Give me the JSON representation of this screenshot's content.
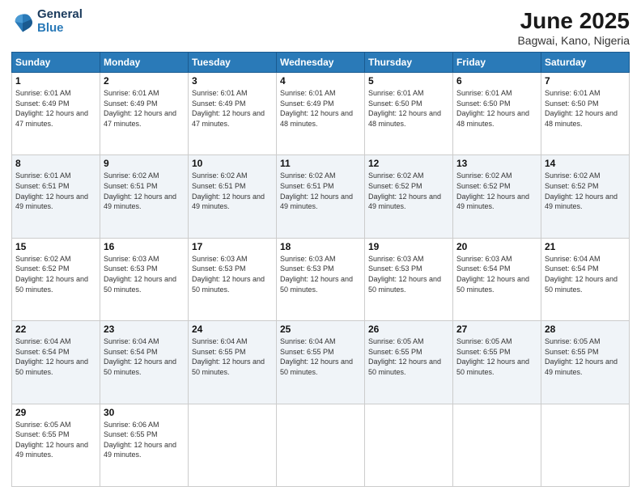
{
  "logo": {
    "line1": "General",
    "line2": "Blue"
  },
  "title": "June 2025",
  "location": "Bagwai, Kano, Nigeria",
  "weekdays": [
    "Sunday",
    "Monday",
    "Tuesday",
    "Wednesday",
    "Thursday",
    "Friday",
    "Saturday"
  ],
  "weeks": [
    [
      {
        "day": "1",
        "sunrise": "6:01 AM",
        "sunset": "6:49 PM",
        "daylight": "12 hours and 47 minutes."
      },
      {
        "day": "2",
        "sunrise": "6:01 AM",
        "sunset": "6:49 PM",
        "daylight": "12 hours and 47 minutes."
      },
      {
        "day": "3",
        "sunrise": "6:01 AM",
        "sunset": "6:49 PM",
        "daylight": "12 hours and 47 minutes."
      },
      {
        "day": "4",
        "sunrise": "6:01 AM",
        "sunset": "6:49 PM",
        "daylight": "12 hours and 48 minutes."
      },
      {
        "day": "5",
        "sunrise": "6:01 AM",
        "sunset": "6:50 PM",
        "daylight": "12 hours and 48 minutes."
      },
      {
        "day": "6",
        "sunrise": "6:01 AM",
        "sunset": "6:50 PM",
        "daylight": "12 hours and 48 minutes."
      },
      {
        "day": "7",
        "sunrise": "6:01 AM",
        "sunset": "6:50 PM",
        "daylight": "12 hours and 48 minutes."
      }
    ],
    [
      {
        "day": "8",
        "sunrise": "6:01 AM",
        "sunset": "6:51 PM",
        "daylight": "12 hours and 49 minutes."
      },
      {
        "day": "9",
        "sunrise": "6:02 AM",
        "sunset": "6:51 PM",
        "daylight": "12 hours and 49 minutes."
      },
      {
        "day": "10",
        "sunrise": "6:02 AM",
        "sunset": "6:51 PM",
        "daylight": "12 hours and 49 minutes."
      },
      {
        "day": "11",
        "sunrise": "6:02 AM",
        "sunset": "6:51 PM",
        "daylight": "12 hours and 49 minutes."
      },
      {
        "day": "12",
        "sunrise": "6:02 AM",
        "sunset": "6:52 PM",
        "daylight": "12 hours and 49 minutes."
      },
      {
        "day": "13",
        "sunrise": "6:02 AM",
        "sunset": "6:52 PM",
        "daylight": "12 hours and 49 minutes."
      },
      {
        "day": "14",
        "sunrise": "6:02 AM",
        "sunset": "6:52 PM",
        "daylight": "12 hours and 49 minutes."
      }
    ],
    [
      {
        "day": "15",
        "sunrise": "6:02 AM",
        "sunset": "6:52 PM",
        "daylight": "12 hours and 50 minutes."
      },
      {
        "day": "16",
        "sunrise": "6:03 AM",
        "sunset": "6:53 PM",
        "daylight": "12 hours and 50 minutes."
      },
      {
        "day": "17",
        "sunrise": "6:03 AM",
        "sunset": "6:53 PM",
        "daylight": "12 hours and 50 minutes."
      },
      {
        "day": "18",
        "sunrise": "6:03 AM",
        "sunset": "6:53 PM",
        "daylight": "12 hours and 50 minutes."
      },
      {
        "day": "19",
        "sunrise": "6:03 AM",
        "sunset": "6:53 PM",
        "daylight": "12 hours and 50 minutes."
      },
      {
        "day": "20",
        "sunrise": "6:03 AM",
        "sunset": "6:54 PM",
        "daylight": "12 hours and 50 minutes."
      },
      {
        "day": "21",
        "sunrise": "6:04 AM",
        "sunset": "6:54 PM",
        "daylight": "12 hours and 50 minutes."
      }
    ],
    [
      {
        "day": "22",
        "sunrise": "6:04 AM",
        "sunset": "6:54 PM",
        "daylight": "12 hours and 50 minutes."
      },
      {
        "day": "23",
        "sunrise": "6:04 AM",
        "sunset": "6:54 PM",
        "daylight": "12 hours and 50 minutes."
      },
      {
        "day": "24",
        "sunrise": "6:04 AM",
        "sunset": "6:55 PM",
        "daylight": "12 hours and 50 minutes."
      },
      {
        "day": "25",
        "sunrise": "6:04 AM",
        "sunset": "6:55 PM",
        "daylight": "12 hours and 50 minutes."
      },
      {
        "day": "26",
        "sunrise": "6:05 AM",
        "sunset": "6:55 PM",
        "daylight": "12 hours and 50 minutes."
      },
      {
        "day": "27",
        "sunrise": "6:05 AM",
        "sunset": "6:55 PM",
        "daylight": "12 hours and 50 minutes."
      },
      {
        "day": "28",
        "sunrise": "6:05 AM",
        "sunset": "6:55 PM",
        "daylight": "12 hours and 49 minutes."
      }
    ],
    [
      {
        "day": "29",
        "sunrise": "6:05 AM",
        "sunset": "6:55 PM",
        "daylight": "12 hours and 49 minutes."
      },
      {
        "day": "30",
        "sunrise": "6:06 AM",
        "sunset": "6:55 PM",
        "daylight": "12 hours and 49 minutes."
      },
      null,
      null,
      null,
      null,
      null
    ]
  ]
}
